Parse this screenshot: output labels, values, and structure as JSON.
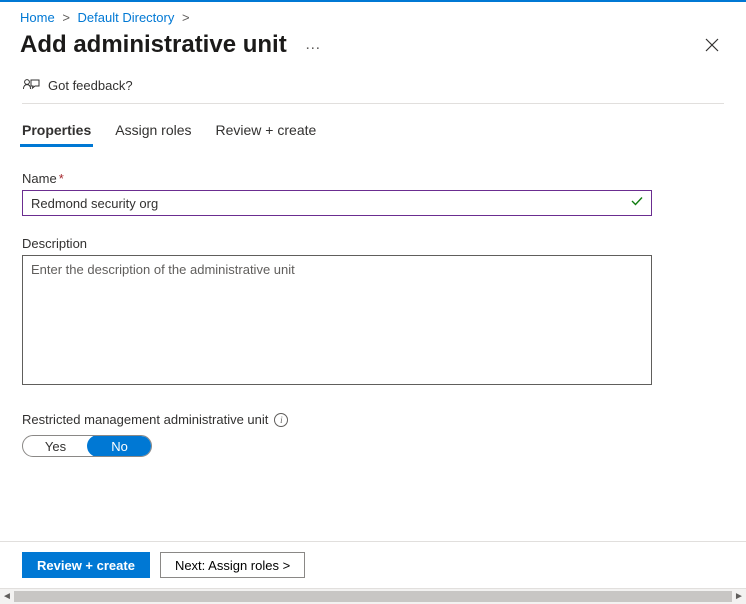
{
  "breadcrumb": {
    "items": [
      {
        "label": "Home"
      },
      {
        "label": "Default Directory"
      }
    ],
    "separator": ">"
  },
  "page": {
    "title": "Add administrative unit",
    "more": "…",
    "feedback_label": "Got feedback?"
  },
  "tabs": {
    "items": [
      {
        "label": "Properties",
        "active": true
      },
      {
        "label": "Assign roles",
        "active": false
      },
      {
        "label": "Review + create",
        "active": false
      }
    ]
  },
  "form": {
    "name_label": "Name",
    "name_required": "*",
    "name_value": "Redmond security org",
    "description_label": "Description",
    "description_placeholder": "Enter the description of the administrative unit",
    "description_value": "",
    "restricted_label": "Restricted management administrative unit",
    "toggle": {
      "yes": "Yes",
      "no": "No",
      "selected": "No"
    }
  },
  "footer": {
    "primary": "Review + create",
    "secondary": "Next: Assign roles >"
  }
}
